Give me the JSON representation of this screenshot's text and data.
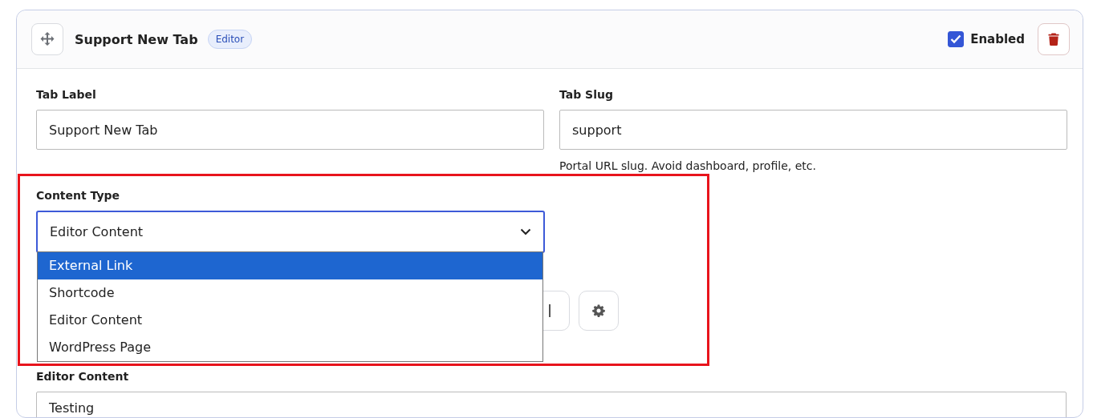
{
  "card": {
    "title": "Support New Tab",
    "badge": "Editor",
    "enabled": {
      "label": "Enabled",
      "checked": true
    }
  },
  "tab_label": {
    "label": "Tab Label",
    "value": "Support New Tab"
  },
  "tab_slug": {
    "label": "Tab Slug",
    "value": "support",
    "hint": "Portal URL slug. Avoid dashboard, profile, etc."
  },
  "content_type": {
    "label": "Content Type",
    "value": "Editor Content",
    "expanded": true,
    "options": [
      {
        "label": "External Link",
        "highlighted": true
      },
      {
        "label": "Shortcode",
        "highlighted": false
      },
      {
        "label": "Editor Content",
        "highlighted": false
      },
      {
        "label": "WordPress Page",
        "highlighted": false
      }
    ]
  },
  "editor_content": {
    "label": "Editor Content",
    "value": "Testing"
  }
}
